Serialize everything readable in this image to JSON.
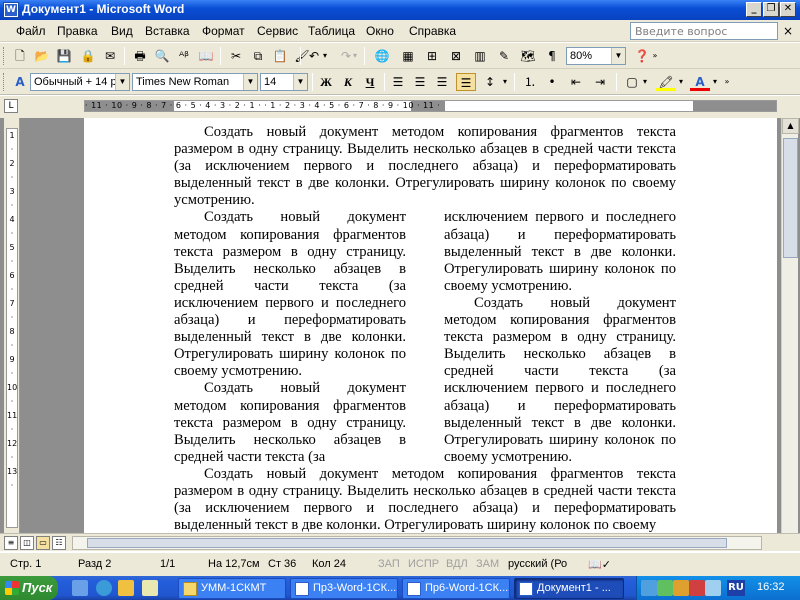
{
  "window": {
    "title": "Документ1 - Microsoft Word",
    "app_icon": "W"
  },
  "menu": {
    "items": [
      "Файл",
      "Правка",
      "Вид",
      "Вставка",
      "Формат",
      "Сервис",
      "Таблица",
      "Окно",
      "Справка"
    ],
    "help_placeholder": "Введите вопрос",
    "close_glyph": "×"
  },
  "toolbar": {
    "zoom": "80%"
  },
  "format": {
    "style": "Обычный + 14 р",
    "font": "Times New Roman",
    "size": "14",
    "bold": "Ж",
    "italic": "К",
    "underline": "Ч"
  },
  "ruler": {
    "horizontal": "· 11 · 10 · 9 · 8 · 7 · 6 · 5 · 4 · 3 · 2 · 1 ·   · 1 · 2 · 3 · 4 · 5 · 6 · 7 · 8 · 9 · 10 · 11 ·",
    "vertical": "1 · 2 · 3 · 4 · 5 · 6 · 7 · 8 · 9 · 10 · 11 · 12 · 13 ·"
  },
  "document": {
    "para_top": "Создать новый документ методом копирования фрагментов текста размером в одну страницу. Выделить несколько абзацев в средней части текста (за исключением первого и последнего абзаца) и переформатировать выделенный текст в две колонки. Отрегулировать ширину колонок по своему усмотрению.",
    "col_left": [
      "Создать новый документ методом копирования фрагментов текста размером в одну страницу. Выделить несколько абзацев в средней части текста (за исключением первого и последнего абзаца) и переформатировать выделенный текст в две колонки. Отрегулировать ширину колонок по своему усмотрению.",
      "Создать новый документ методом копирования фрагментов текста размером в одну страницу. Выделить несколько абзацев в средней части текста (за"
    ],
    "col_right_cont": "исключением первого и последнего абзаца) и переформатировать выделенный текст в две колонки. Отрегулировать ширину колонок по своему усмотрению.",
    "col_right": [
      "Создать новый документ методом копирования фрагментов текста размером в одну страницу. Выделить несколько абзацев в средней части текста (за исключением первого и последнего абзаца) и переформатировать выделенный текст в две колонки. Отрегулировать ширину колонок по своему усмотрению."
    ],
    "para_bottom": "Создать новый документ методом копирования фрагментов текста размером в одну страницу. Выделить несколько абзацев в средней части текста (за исключением первого и последнего абзаца) и переформатировать выделенный текст в две колонки. Отрегулировать ширину колонок по своему"
  },
  "status": {
    "page": "Стр. 1",
    "section": "Разд 2",
    "pages": "1/1",
    "position": "На 12,7см",
    "line": "Ст 36",
    "column": "Кол 24",
    "rec": "ЗАП",
    "trk": "ИСПР",
    "ext": "ВДЛ",
    "ovr": "ЗАМ",
    "language": "русский (Ро"
  },
  "taskbar": {
    "start": "Пуск",
    "tasks": [
      "УММ-1СКМТ",
      "Пр3-Word-1СК...",
      "Пр6-Word-1СК...",
      "Документ1 - ..."
    ],
    "lang": "RU",
    "clock": "16:32"
  }
}
